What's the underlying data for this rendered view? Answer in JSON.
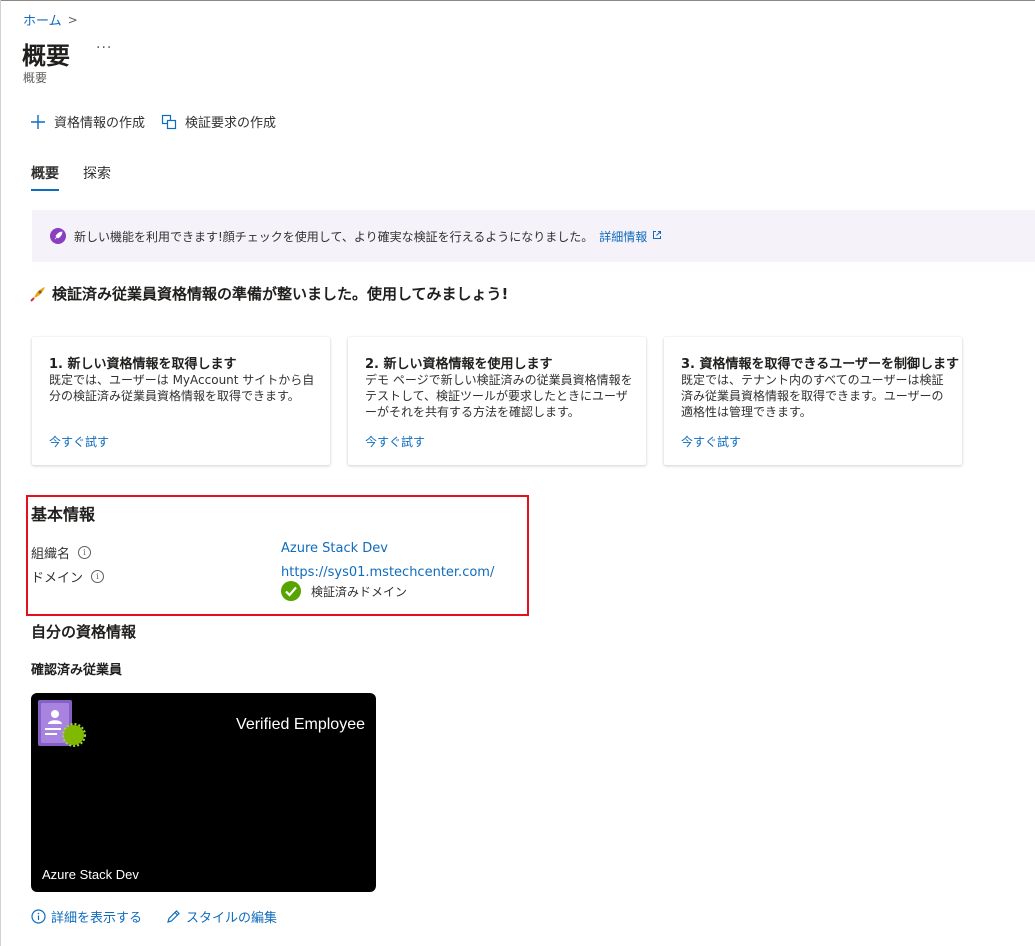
{
  "breadcrumb": {
    "home": "ホーム",
    "separator": ">"
  },
  "page": {
    "title": "概要",
    "more": "···",
    "subtitle": "概要"
  },
  "commands": {
    "create_credential": "資格情報の作成",
    "create_verification_request": "検証要求の作成"
  },
  "tabs": [
    {
      "label": "概要",
      "active": true
    },
    {
      "label": "探索",
      "active": false
    }
  ],
  "banner": {
    "text": "新しい機能を利用できます!顔チェックを使用して、より確実な検証を行えるようになりました。",
    "link": "詳細情報",
    "icon": "rocket-icon"
  },
  "ready": {
    "title": "検証済み従業員資格情報の準備が整いました。使用してみましょう!",
    "icon": "rocket-icon"
  },
  "cards": [
    {
      "title": "1. 新しい資格情報を取得します",
      "desc": "既定では、ユーザーは MyAccount サイトから自分の検証済み従業員資格情報を取得できます。",
      "link": "今すぐ試す"
    },
    {
      "title": "2. 新しい資格情報を使用します",
      "desc": "デモ ページで新しい検証済みの従業員資格情報をテストして、検証ツールが要求したときにユーザーがそれを共有する方法を確認します。",
      "link": "今すぐ試す"
    },
    {
      "title": "3. 資格情報を取得できるユーザーを制御します",
      "desc": "既定では、テナント内のすべてのユーザーは検証済み従業員資格情報を取得できます。ユーザーの適格性は管理できます。",
      "link": "今すぐ試す"
    }
  ],
  "basic": {
    "title": "基本情報",
    "org_label": "組織名",
    "org_value": "Azure Stack Dev",
    "domain_label": "ドメイン",
    "domain_value": "https://sys01.mstechcenter.com/",
    "verified_text": "検証済みドメイン"
  },
  "my_credentials": {
    "title": "自分の資格情報",
    "subtitle": "確認済み従業員",
    "card_title": "Verified Employee",
    "card_org": "Azure Stack Dev"
  },
  "actions": {
    "view_details": "詳細を表示する",
    "edit_style": "スタイルの編集"
  },
  "colors": {
    "accent": "#0f6cbd",
    "highlight_border": "#e3111d",
    "banner_bg": "#f5f2f9",
    "verified_green": "#57a300",
    "card_bg": "#000000"
  }
}
